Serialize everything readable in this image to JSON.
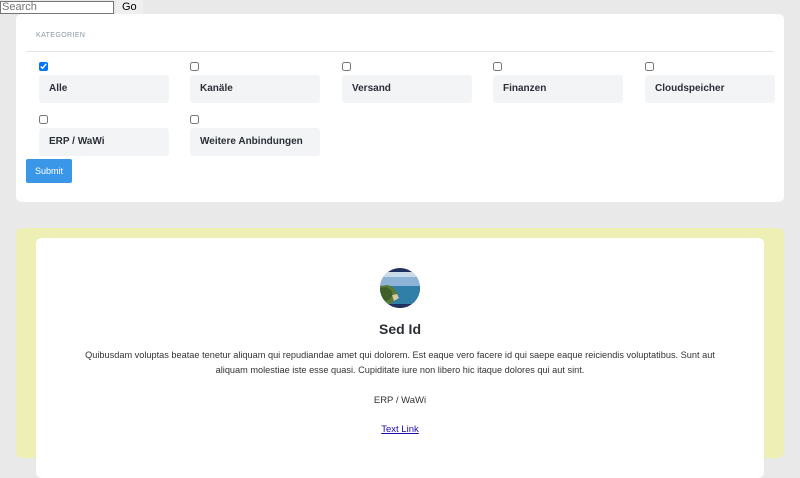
{
  "search": {
    "placeholder": "Search",
    "value": "",
    "go_label": "Go"
  },
  "filter": {
    "heading": "KATEGORIEN",
    "categories": [
      {
        "label": "Alle",
        "checked": true
      },
      {
        "label": "Kanäle",
        "checked": false
      },
      {
        "label": "Versand",
        "checked": false
      },
      {
        "label": "Finanzen",
        "checked": false
      },
      {
        "label": "Cloudspeicher",
        "checked": false
      },
      {
        "label": "ERP / WaWi",
        "checked": false
      },
      {
        "label": "Weitere Anbindungen",
        "checked": false
      }
    ],
    "submit_label": "Submit"
  },
  "result": {
    "title": "Sed Id",
    "description": "Quibusdam voluptas beatae tenetur aliquam qui repudiandae amet qui dolorem. Est eaque vero facere id qui saepe eaque reiciendis voluptatibus. Sunt aut aliquam molestiae iste esse quasi. Cupiditate iure non libero hic itaque dolores qui aut sint.",
    "category": "ERP / WaWi",
    "link_label": "Text Link",
    "avatar_icon": "coastal-landscape-image"
  },
  "colors": {
    "page_background": "#e9e9e9",
    "submit_button": "#3a97e8",
    "result_background": "#edefb5",
    "link": "#1a0dab"
  }
}
